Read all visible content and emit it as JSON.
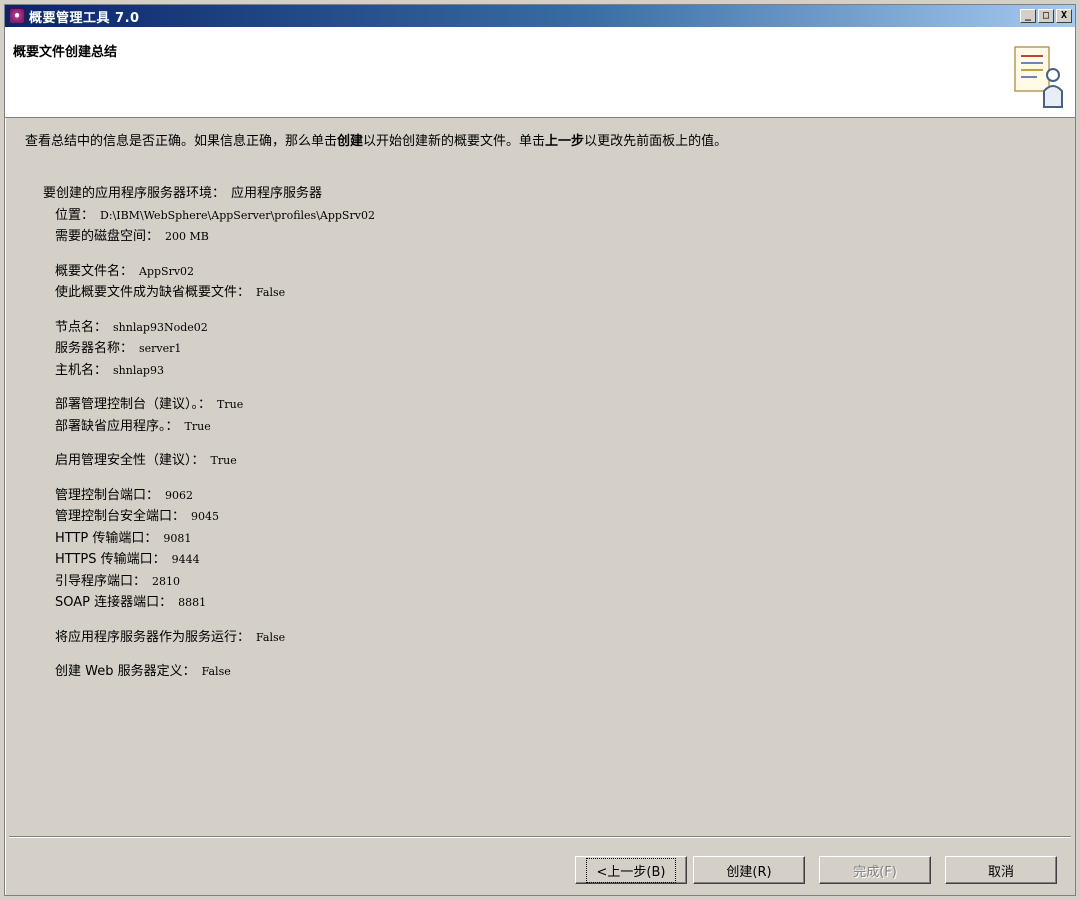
{
  "window": {
    "title": "概要管理工具 7.0",
    "controls": {
      "minimize": "_",
      "maximize": "□",
      "close": "X"
    }
  },
  "header": {
    "title": "概要文件创建总结",
    "icon": "document-person-icon"
  },
  "instruction": {
    "part1": "查看总结中的信息是否正确。如果信息正确，那么单击",
    "bold1": "创建",
    "part2": "以开始创建新的概要文件。单击",
    "bold2": "上一步",
    "part3": "以更改先前面板上的值。"
  },
  "summary": {
    "environment": {
      "label": "要创建的应用程序服务器环境：",
      "value": "应用程序服务器"
    },
    "location": {
      "label": "位置：",
      "value": "D:\\IBM\\WebSphere\\AppServer\\profiles\\AppSrv02"
    },
    "disk_space": {
      "label": "需要的磁盘空间：",
      "value": "200 MB"
    },
    "profile_name": {
      "label": "概要文件名：",
      "value": "AppSrv02"
    },
    "default_profile": {
      "label": "使此概要文件成为缺省概要文件：",
      "value": "False"
    },
    "node_name": {
      "label": "节点名：",
      "value": "shnlap93Node02"
    },
    "server_name": {
      "label": "服务器名称：",
      "value": "server1"
    },
    "host_name": {
      "label": "主机名：",
      "value": "shnlap93"
    },
    "deploy_console": {
      "label": "部署管理控制台（建议）。：",
      "value": "True"
    },
    "deploy_default_apps": {
      "label": "部署缺省应用程序。：",
      "value": "True"
    },
    "admin_security": {
      "label": "启用管理安全性（建议）：",
      "value": "True"
    },
    "console_port": {
      "label": "管理控制台端口：",
      "value": "9062"
    },
    "console_secure_port": {
      "label": "管理控制台安全端口：",
      "value": "9045"
    },
    "http_port": {
      "label": "HTTP 传输端口：",
      "value": "9081"
    },
    "https_port": {
      "label": "HTTPS 传输端口：",
      "value": "9444"
    },
    "bootstrap_port": {
      "label": "引导程序端口：",
      "value": "2810"
    },
    "soap_port": {
      "label": "SOAP 连接器端口：",
      "value": "8881"
    },
    "run_as_service": {
      "label": "将应用程序服务器作为服务运行：",
      "value": "False"
    },
    "web_server_def": {
      "label": "创建 Web 服务器定义：",
      "value": "False"
    }
  },
  "buttons": {
    "back": "<上一步(B)",
    "create": "创建(R)",
    "finish": "完成(F)",
    "cancel": "取消"
  }
}
